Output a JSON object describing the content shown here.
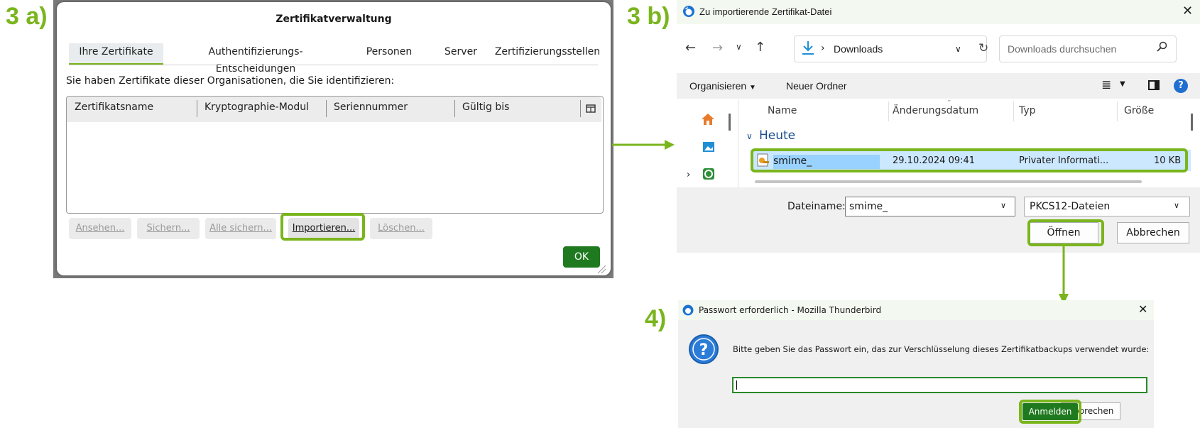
{
  "steps": {
    "a": "3 a)",
    "b": "3 b)",
    "c": "4)"
  },
  "cert_manager": {
    "title": "Zertifikatverwaltung",
    "tabs": [
      "Ihre Zertifikate",
      "Authentifizierungs-Entscheidungen",
      "Personen",
      "Server",
      "Zertifizierungsstellen"
    ],
    "active_tab": 0,
    "description": "Sie haben Zertifikate dieser Organisationen, die Sie identifizieren:",
    "columns": [
      "Zertifikatsname",
      "Kryptographie-Modul",
      "Seriennummer",
      "Gültig bis"
    ],
    "buttons": {
      "view": "Ansehen...",
      "backup": "Sichern...",
      "backup_all": "Alle sichern...",
      "import": "Importieren...",
      "delete": "Löschen..."
    },
    "ok": "OK"
  },
  "file_dialog": {
    "title": "Zu importierende Zertifikat-Datei",
    "location": "Downloads",
    "search_placeholder": "Downloads durchsuchen",
    "organize": "Organisieren",
    "new_folder": "Neuer Ordner",
    "columns": [
      "Name",
      "Änderungsdatum",
      "Typ",
      "Größe"
    ],
    "group": "Heute",
    "file": {
      "name": "smime_",
      "date": "29.10.2024 09:41",
      "type": "Privater Informati...",
      "size": "10 KB"
    },
    "filename_label": "Dateiname:",
    "filename_value": "smime_",
    "filter": "PKCS12-Dateien",
    "open": "Öffnen",
    "cancel": "Abbrechen"
  },
  "password_dialog": {
    "title": "Passwort erforderlich - Mozilla Thunderbird",
    "message": "Bitte geben Sie das Passwort ein, das zur Verschlüsselung dieses Zertifikatbackups verwendet wurde:",
    "password_value": "",
    "login": "Anmelden",
    "cancel": "Abbrechen"
  },
  "colors": {
    "accent": "#7ab51d",
    "ok_green": "#1f7a1f",
    "selection": "#cce8ff"
  }
}
